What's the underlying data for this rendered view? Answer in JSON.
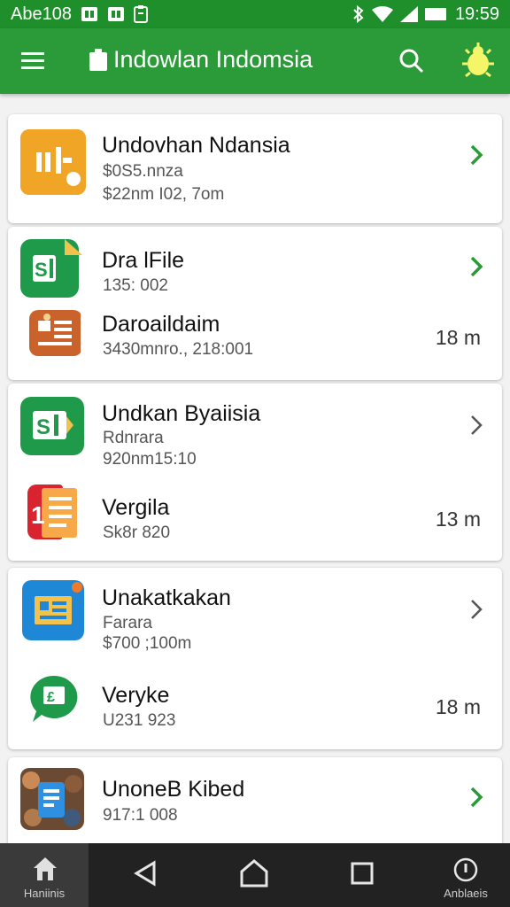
{
  "status_bar": {
    "carrier": "Abe108",
    "time": "19:59"
  },
  "app_bar": {
    "title": "Indowlan Indomsia"
  },
  "cards": [
    {
      "rows": [
        {
          "title": "Undovhan Ndansia",
          "sub1": "$0S5.nnza",
          "sub2": "$22nm I02, 7om",
          "size": ""
        }
      ]
    },
    {
      "rows": [
        {
          "title": "Dra lFile",
          "sub1": "135: 002",
          "sub2": "",
          "size": ""
        },
        {
          "title": "Daroaildaim",
          "sub1": "3430mnro., 218:001",
          "sub2": "",
          "size": "18 m"
        }
      ]
    },
    {
      "rows": [
        {
          "title": "Undkan Byaiisia",
          "sub1": "Rdnrara",
          "sub2": "920nm15:10",
          "size": ""
        },
        {
          "title": "Vergila",
          "sub1": "Sk8r 820",
          "sub2": "",
          "size": "13 m"
        }
      ]
    },
    {
      "rows": [
        {
          "title": "Unakatkakan",
          "sub1": "Farara",
          "sub2": "$700 ;100m",
          "size": ""
        },
        {
          "title": "Veryke",
          "sub1": "U231 923",
          "sub2": "",
          "size": "18 m"
        }
      ]
    },
    {
      "rows": [
        {
          "title": "UnoneB Kibed",
          "sub1": "917:1 008",
          "sub2": "",
          "size": ""
        }
      ]
    }
  ],
  "bottom_nav": {
    "home_label": "Haniinis",
    "about_label": "Anblaeis"
  },
  "colors": {
    "primary": "#2b9a38",
    "status": "#1f8f2c",
    "chevron_active": "#2b9a38",
    "chevron_inactive": "#555555"
  }
}
